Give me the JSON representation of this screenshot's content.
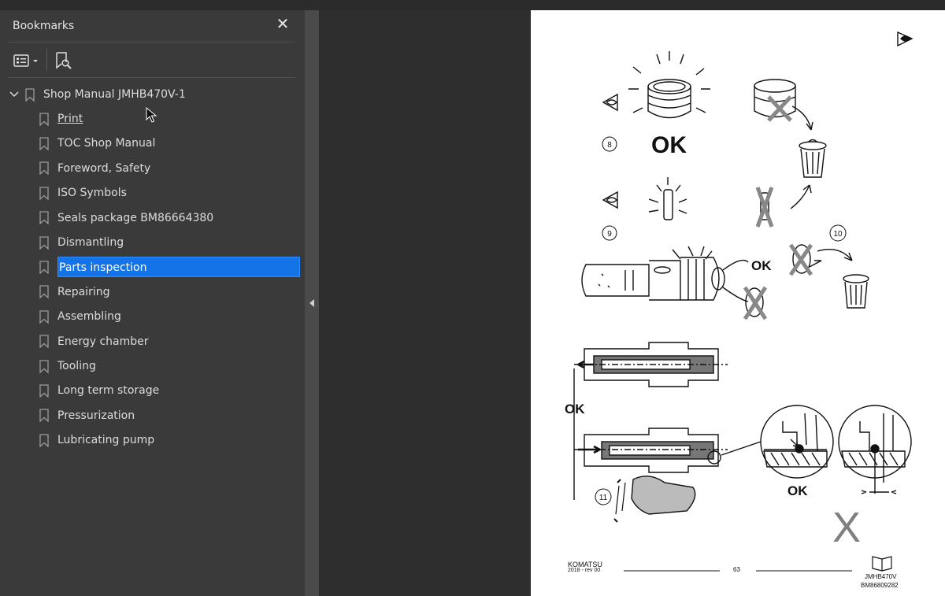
{
  "bookmarks_panel": {
    "title": "Bookmarks",
    "close_glyph": "✕",
    "root": "Shop Manual  JMHB470V-1",
    "items": [
      {
        "label": "Print",
        "underlined": true
      },
      {
        "label": "TOC Shop Manual"
      },
      {
        "label": "Foreword, Safety"
      },
      {
        "label": "ISO Symbols"
      },
      {
        "label": "Seals package BM86664380"
      },
      {
        "label": "Dismantling"
      },
      {
        "label": "Parts inspection",
        "selected": true
      },
      {
        "label": "Repairing"
      },
      {
        "label": "Assembling"
      },
      {
        "label": "Energy chamber"
      },
      {
        "label": "Tooling"
      },
      {
        "label": "Long term storage"
      },
      {
        "label": "Pressurization"
      },
      {
        "label": "Lubricating pump"
      }
    ],
    "selected_color": "#1473e6"
  },
  "page": {
    "figure_labels": {
      "ok_big": "OK",
      "ok_mid": "OK",
      "ok_left": "OK",
      "ok_detail": "OK",
      "num_8": "8",
      "num_9": "9",
      "num_10": "10",
      "num_11": "11",
      "x_big": "X"
    },
    "footer": {
      "brand": "KOMATSU",
      "rev": "2018 -  rev 00",
      "page_number": "63",
      "model": "JMHB470V",
      "doc": "BM86809282"
    }
  }
}
